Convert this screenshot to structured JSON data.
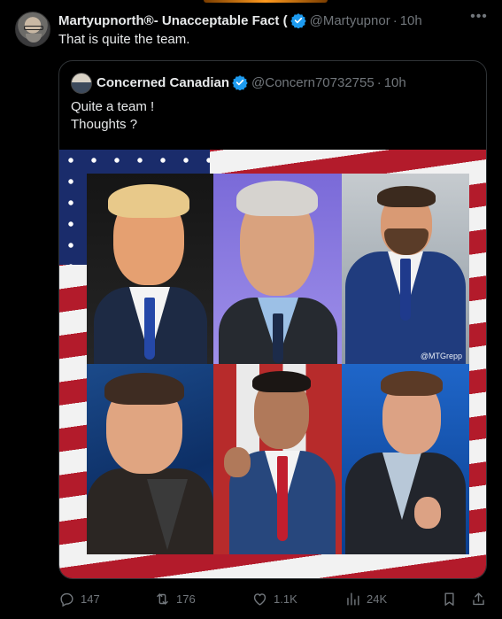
{
  "post": {
    "display_name": "Martyupnorth®- Unacceptable Fact (",
    "handle": "@Martyupnor",
    "separator": "·",
    "time": "10h",
    "text": "That is quite the team.",
    "more_icon": "more-horizontal-icon"
  },
  "quote": {
    "display_name": "Concerned Canadian",
    "handle": "@Concern70732755",
    "separator": "·",
    "time": "10h",
    "text_lines": [
      "Quite a team !",
      "Thoughts ?"
    ],
    "media": {
      "watermark": "@MTGrepp",
      "panels": 6
    }
  },
  "actions": {
    "replies": "147",
    "reposts": "176",
    "likes": "1.1K",
    "views": "24K",
    "icons": [
      "reply-icon",
      "repost-icon",
      "like-icon",
      "views-icon",
      "bookmark-icon",
      "share-icon"
    ]
  },
  "colors": {
    "background": "#000000",
    "text": "#e7e9ea",
    "muted": "#71767b",
    "verified": "#1d9bf0",
    "border": "#2f3336"
  }
}
